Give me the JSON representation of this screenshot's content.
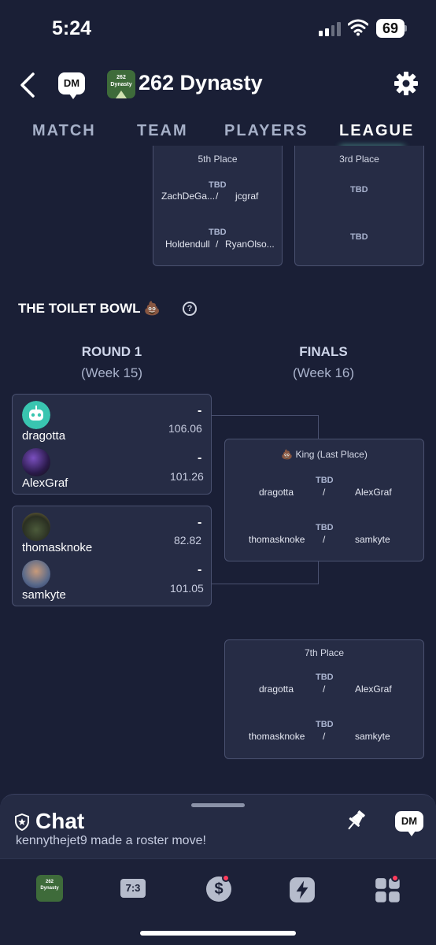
{
  "status_bar": {
    "time": "5:24",
    "battery": "69"
  },
  "header": {
    "dm_label": "DM",
    "logo_text": "262 Dynasty",
    "league_name": "262 Dynasty"
  },
  "tabs": [
    {
      "label": "MATCH"
    },
    {
      "label": "TEAM"
    },
    {
      "label": "PLAYERS"
    },
    {
      "label": "LEAGUE"
    }
  ],
  "upper_bracket": {
    "fifth_place": {
      "title": "5th Place",
      "games": [
        {
          "status": "TBD",
          "left": "ZachDeGa...",
          "sep": "/",
          "right": "jcgraf"
        },
        {
          "status": "TBD",
          "left": "Holdendull",
          "sep": "/",
          "right": "RyanOlso..."
        }
      ]
    },
    "third_place": {
      "title": "3rd Place",
      "games": [
        {
          "status": "TBD"
        },
        {
          "status": "TBD"
        }
      ]
    }
  },
  "toilet_bowl": {
    "title": "THE TOILET BOWL 💩",
    "help": "?",
    "round1": {
      "title": "ROUND 1",
      "week": "(Week 15)"
    },
    "finals": {
      "title": "FINALS",
      "week": "(Week 16)"
    },
    "matchups": [
      {
        "teams": [
          {
            "name": "dragotta",
            "dash": "-",
            "score": "106.06"
          },
          {
            "name": "AlexGraf",
            "dash": "-",
            "score": "101.26"
          }
        ]
      },
      {
        "teams": [
          {
            "name": "thomasknoke",
            "dash": "-",
            "score": "82.82"
          },
          {
            "name": "samkyte",
            "dash": "-",
            "score": "101.05"
          }
        ]
      }
    ],
    "king": {
      "title": "💩 King (Last Place)",
      "games": [
        {
          "status": "TBD",
          "left": "dragotta",
          "sep": "/",
          "right": "AlexGraf"
        },
        {
          "status": "TBD",
          "left": "thomasknoke",
          "sep": "/",
          "right": "samkyte"
        }
      ]
    },
    "seventh": {
      "title": "7th Place",
      "games": [
        {
          "status": "TBD",
          "left": "dragotta",
          "sep": "/",
          "right": "AlexGraf"
        },
        {
          "status": "TBD",
          "left": "thomasknoke",
          "sep": "/",
          "right": "samkyte"
        }
      ]
    }
  },
  "chat": {
    "title": "Chat",
    "message": "kennythejet9 made a roster move!",
    "dm_label": "DM"
  },
  "bottom_nav": {
    "logo_text": "262 Dynasty",
    "matchup_icon_text": "7:3",
    "money_icon": "$",
    "colors": {
      "badge": "#ff3b5c",
      "accent": "#6fe0c6"
    }
  }
}
